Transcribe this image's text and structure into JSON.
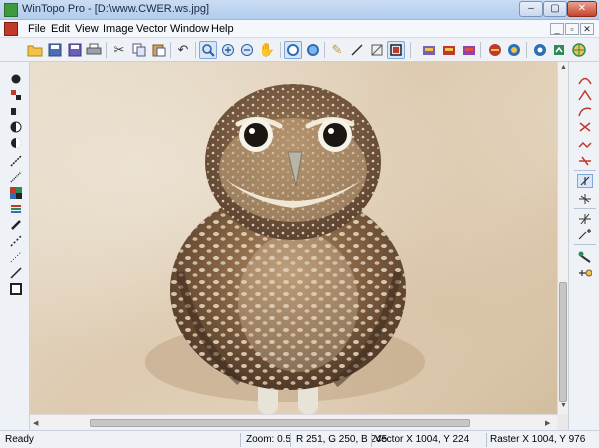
{
  "window": {
    "title": "WinTopo Pro - [D:\\www.CWER.ws.jpg]",
    "minimize": "–",
    "restore": "▢",
    "close": "✕"
  },
  "menu": {
    "items": [
      "File",
      "Edit",
      "View",
      "Image",
      "Vector",
      "Window",
      "Help"
    ],
    "mdi_minimize": "_",
    "mdi_restore": "▫",
    "mdi_close": "✕"
  },
  "toolbar": {
    "icons": [
      "open-folder",
      "save",
      "save-as",
      "print",
      "cut",
      "copy",
      "paste",
      "undo",
      "zoom-tool",
      "zoom-in",
      "zoom-out",
      "pan-hand",
      "raster-view",
      "vector-view",
      "pencil",
      "line-edit",
      "polygon-edit",
      "select-box",
      "convert-1",
      "convert-2",
      "convert-3",
      "convert-4",
      "convert-5",
      "settings",
      "export",
      "world"
    ]
  },
  "canvas": {
    "subject": "owl photo"
  },
  "status": {
    "ready": "Ready",
    "zoom": "Zoom: 0.5",
    "color": "R 251, G 250, B 245",
    "vector": "Vector  X 1004, Y 224",
    "raster": "Raster  X 1004, Y 976"
  }
}
